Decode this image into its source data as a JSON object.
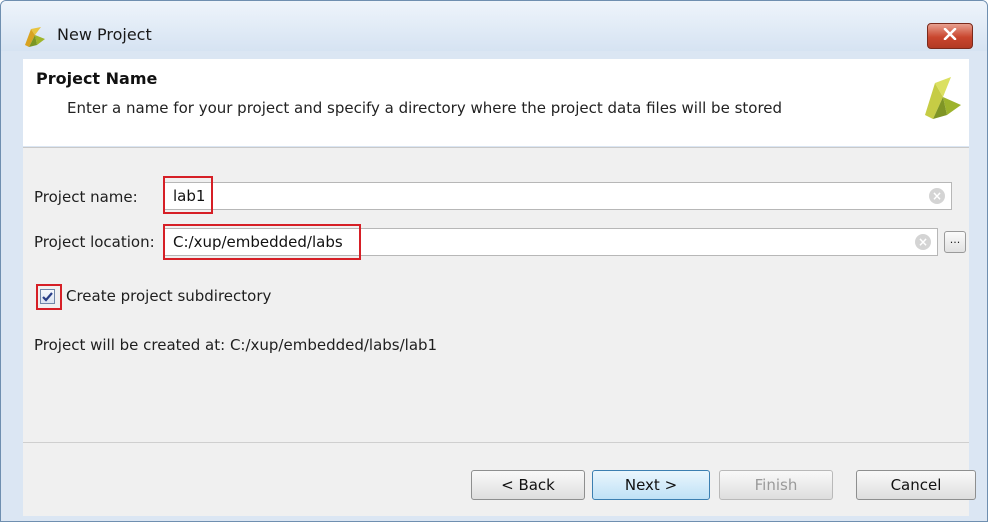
{
  "window": {
    "title": "New Project"
  },
  "header": {
    "title": "Project Name",
    "description": "Enter a name for your project and specify a directory where the project data files will be stored"
  },
  "form": {
    "project_name_label": "Project name:",
    "project_name_value": "lab1",
    "project_location_label": "Project location:",
    "project_location_value": "C:/xup/embedded/labs",
    "browse_label": "...",
    "create_subdir_label": "Create project subdirectory",
    "create_subdir_checked": true,
    "created_at_text": "Project will be created at: C:/xup/embedded/labs/lab1"
  },
  "buttons": {
    "back": "< Back",
    "next": "Next >",
    "finish": "Finish",
    "cancel": "Cancel"
  },
  "colors": {
    "highlight": "#d61f26",
    "logo": "#b8c23a"
  },
  "icons": {
    "app": "vivado-logo-icon",
    "close": "close-icon",
    "clear": "clear-icon"
  }
}
